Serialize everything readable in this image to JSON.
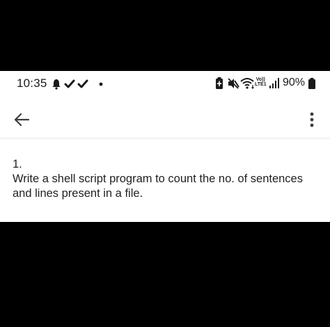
{
  "status_bar": {
    "time": "10:35",
    "notification_icons": [
      "alarm-icon",
      "check-icon",
      "check-icon",
      "dot-icon"
    ],
    "system_icons": [
      "battery-saver-icon",
      "mute-icon",
      "wifi-icon",
      "volte-lte-icon",
      "signal-icon"
    ],
    "volte_top": "Vo))",
    "volte_bottom": "LTE1",
    "battery_percent": "90%"
  },
  "app_bar": {
    "back_icon": "arrow-left-icon",
    "menu_icon": "more-vertical-icon"
  },
  "question": {
    "number": "1.",
    "text": "Write a shell script program to count the no. of sentences and lines present in a file."
  }
}
